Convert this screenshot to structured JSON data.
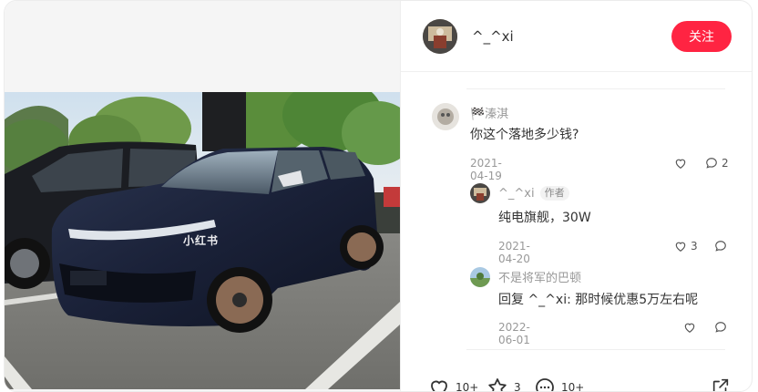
{
  "watermark": "小红书",
  "author": {
    "name": "^_^xi",
    "follow_label": "关注"
  },
  "comments": [
    {
      "name": "🏁溱淇",
      "text": "你这个落地多少钱?",
      "date": "2021-04-19",
      "likes": "",
      "replies": "2"
    },
    {
      "name": "^_^xi",
      "badge": "作者",
      "text": "纯电旗舰，30W",
      "date": "2021-04-20",
      "likes": "3",
      "replies": ""
    },
    {
      "name": "不是将军的巴顿",
      "text": "回复 ^_^xi: 那时候优惠5万左右呢",
      "date": "2022-06-01",
      "likes": "",
      "replies": ""
    }
  ],
  "bottom_bar": {
    "likes": "10+",
    "collects": "3",
    "comments": "10+"
  }
}
